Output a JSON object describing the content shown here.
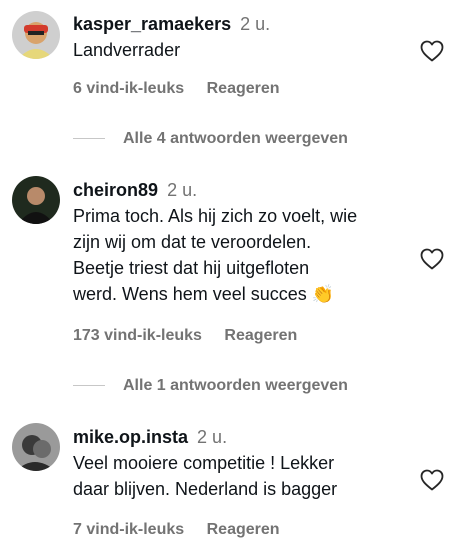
{
  "comments": [
    {
      "username": "kasper_ramaekers",
      "age": "2 u.",
      "text": "Landverrader",
      "likes": "6 vind-ik-leuks",
      "reply_label": "Reageren",
      "view_replies": "Alle 4 antwoorden weergeven"
    },
    {
      "username": "cheiron89",
      "age": "2 u.",
      "text_lines": [
        "Prima toch. Als hij zich zo voelt, wie",
        "zijn wij om dat te veroordelen.",
        "Beetje triest dat hij uitgefloten",
        "werd. Wens hem veel succes"
      ],
      "emoji": "👏",
      "likes": "173 vind-ik-leuks",
      "reply_label": "Reageren",
      "view_replies": "Alle 1 antwoorden weergeven"
    },
    {
      "username": "mike.op.insta",
      "age": "2 u.",
      "text_lines": [
        "Veel mooiere competitie ! Lekker",
        "daar blijven. Nederland is bagger"
      ],
      "likes": "7 vind-ik-leuks",
      "reply_label": "Reageren"
    }
  ],
  "icons": {
    "like": "heart-outline-icon"
  },
  "colors": {
    "text": "#0f1419",
    "secondary": "#737373",
    "divider": "#c7c7c7"
  }
}
